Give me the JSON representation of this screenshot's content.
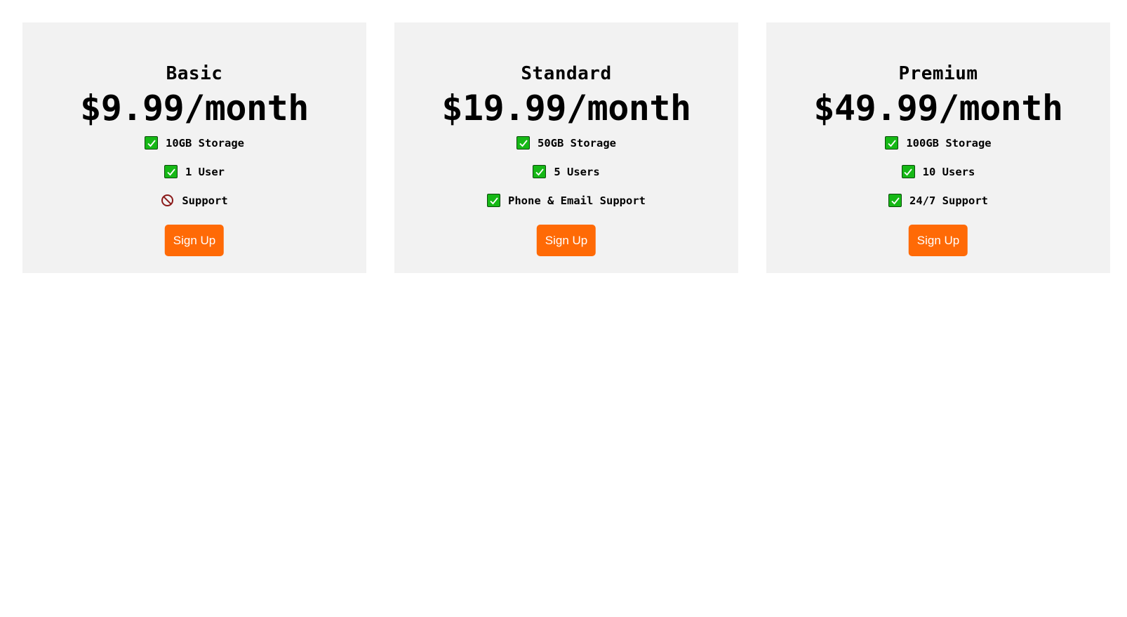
{
  "plans": [
    {
      "name": "Basic",
      "price": "$9.99/month",
      "features": [
        {
          "icon": "check-icon",
          "text": "10GB Storage"
        },
        {
          "icon": "check-icon",
          "text": "1 User"
        },
        {
          "icon": "prohibited-icon",
          "text": "Support"
        }
      ],
      "button_label": "Sign Up"
    },
    {
      "name": "Standard",
      "price": "$19.99/month",
      "features": [
        {
          "icon": "check-icon",
          "text": "50GB Storage"
        },
        {
          "icon": "check-icon",
          "text": "5 Users"
        },
        {
          "icon": "check-icon",
          "text": "Phone & Email Support"
        }
      ],
      "button_label": "Sign Up"
    },
    {
      "name": "Premium",
      "price": "$49.99/month",
      "features": [
        {
          "icon": "check-icon",
          "text": "100GB Storage"
        },
        {
          "icon": "check-icon",
          "text": "10 Users"
        },
        {
          "icon": "check-icon",
          "text": "24/7 Support"
        }
      ],
      "button_label": "Sign Up"
    }
  ],
  "colors": {
    "card_background": "#f2f2f2",
    "button_background": "#ff6a06",
    "button_text": "#ffffff",
    "check_green": "#16b816",
    "prohibited_red": "#8b1a1a"
  }
}
